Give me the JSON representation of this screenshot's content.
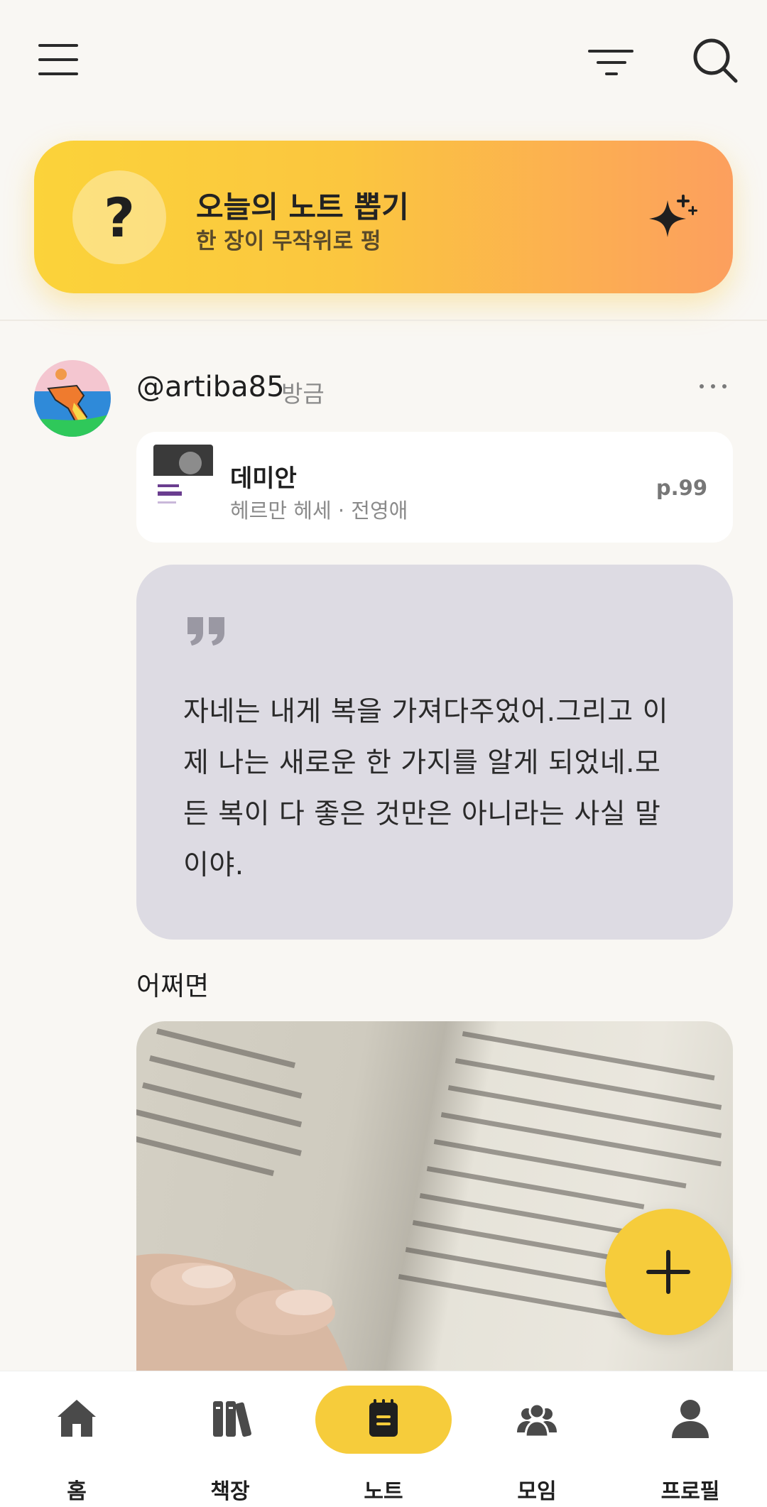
{
  "header": {
    "menu_icon": "hamburger-menu-icon",
    "filter_icon": "filter-icon",
    "search_icon": "search-icon"
  },
  "banner": {
    "icon": "question-mark",
    "icon_text": "?",
    "title": "오늘의 노트 뽑기",
    "subtitle": "한 장이 무작위로 펑",
    "sparkle_icon": "sparkle-icon"
  },
  "post": {
    "username": "@artiba85",
    "time": "방금",
    "more_icon": "more-horizontal-icon",
    "book": {
      "title": "데미안",
      "author": "헤르만 헤세 · 전영애",
      "page": "p.99"
    },
    "quote_icon": "quote-mark-icon",
    "quote_lines": [
      "자네는 내게 복을 가져다주었어.그리고 이",
      "제 나는 새로운 한 가지를 알게 되었네.모",
      "든 복이 다 좋은 것만은 아니라는 사실 말",
      "이야."
    ],
    "memo": "어쩌면",
    "photo": "open-book-photo"
  },
  "fab": {
    "icon": "plus-icon"
  },
  "nav": {
    "items": [
      {
        "label": "홈",
        "icon": "home-icon"
      },
      {
        "label": "책장",
        "icon": "bookshelf-icon"
      },
      {
        "label": "노트",
        "icon": "note-icon",
        "active": true
      },
      {
        "label": "모임",
        "icon": "group-icon"
      },
      {
        "label": "프로필",
        "icon": "profile-icon"
      }
    ]
  },
  "colors": {
    "background": "#f9f7f3",
    "accent": "#f6cc3b",
    "banner_start": "#fbd33a",
    "banner_end": "#fc9f5e",
    "quote_bg": "#dddbe3"
  }
}
